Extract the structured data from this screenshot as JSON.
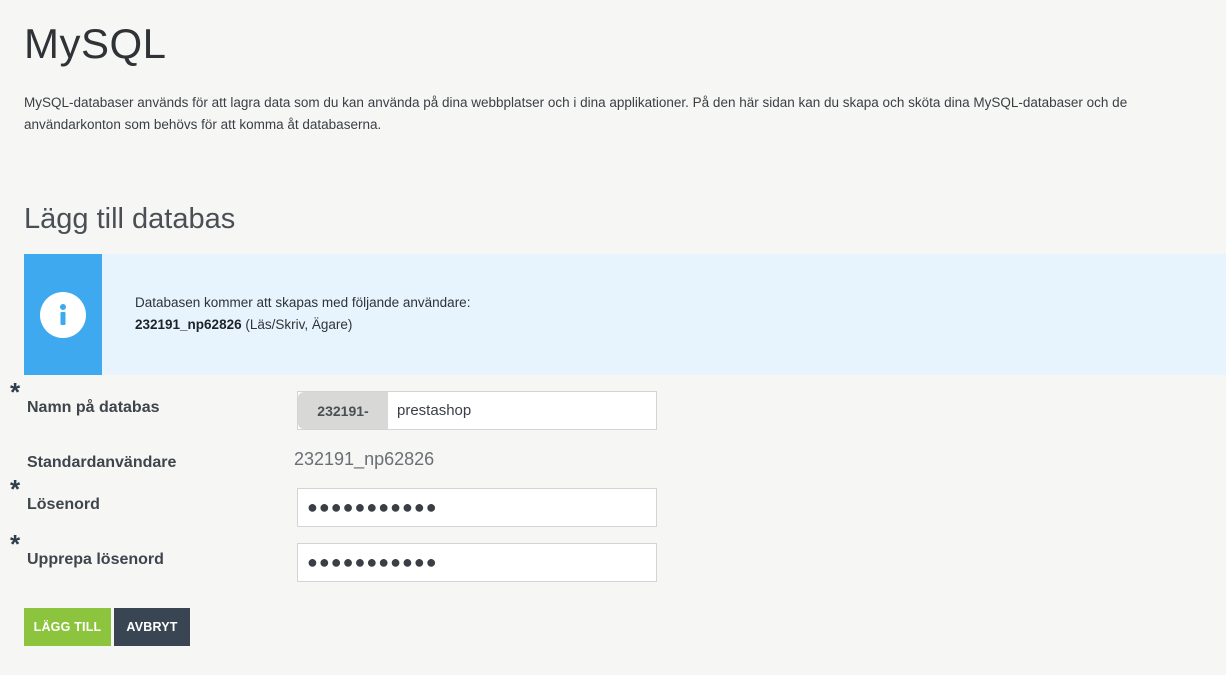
{
  "header": {
    "title": "MySQL",
    "intro_line1": "MySQL-databaser används för att lagra data som du kan använda på dina webbplatser och i dina applikationer. På den här sidan kan du skapa och sköta dina MySQL-databaser och de",
    "intro_line2": "användarkonton som behövs för att komma åt databaserna."
  },
  "section": {
    "title": "Lägg till databas"
  },
  "info": {
    "line1": "Databasen kommer att skapas med följande användare:",
    "user": "232191_np62826",
    "role": " (Läs/Skriv, Ägare)"
  },
  "form": {
    "required_marker": "*",
    "db_name_label": "Namn på databas",
    "db_prefix": "232191-",
    "db_name_value": "prestashop",
    "default_user_label": "Standardanvändare",
    "default_user_value": "232191_np62826",
    "password_label": "Lösenord",
    "password_value": "●●●●●●●●●●●",
    "repeat_password_label": "Upprepa lösenord",
    "repeat_password_value": "●●●●●●●●●●●"
  },
  "buttons": {
    "add_label": "LÄGG TILL",
    "cancel_label": "AVBRYT"
  },
  "colors": {
    "info_strip": "#3ea9ee",
    "info_bg": "#e7f3fd",
    "add_button": "#8cc43e",
    "cancel_button": "#3a4553"
  },
  "icons": {
    "info": "info-icon"
  }
}
